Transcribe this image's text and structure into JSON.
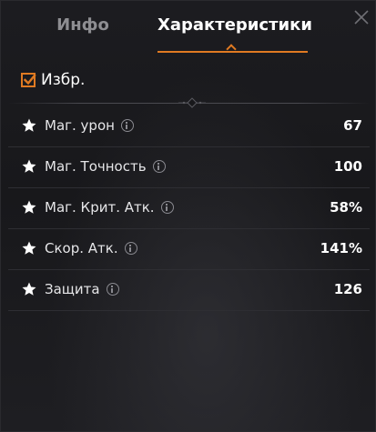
{
  "tabs": {
    "info_label": "Инфо",
    "stats_label": "Характеристики",
    "active": "stats"
  },
  "favorite": {
    "label": "Избр.",
    "checked": true
  },
  "stats": [
    {
      "label": "Маг. урон",
      "value": "67"
    },
    {
      "label": "Маг. Точность",
      "value": "100"
    },
    {
      "label": "Маг. Крит. Атк.",
      "value": "58%"
    },
    {
      "label": "Скор. Атк.",
      "value": "141%"
    },
    {
      "label": "Защита",
      "value": "126"
    }
  ],
  "icons": {
    "close": "close-icon",
    "star": "star-icon",
    "info": "info-icon",
    "check": "checkmark-icon"
  },
  "colors": {
    "accent": "#e07a22",
    "background": "#18181b",
    "inactive_tab": "#8e8e92",
    "text": "#ffffff"
  }
}
